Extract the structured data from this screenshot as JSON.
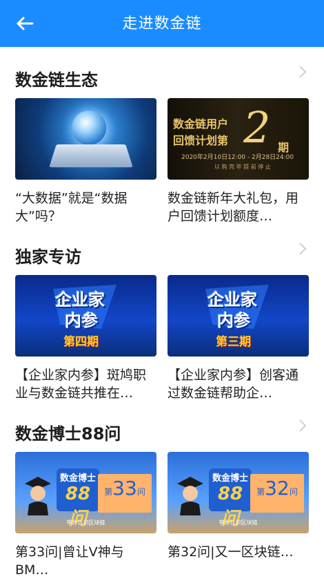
{
  "header": {
    "title": "走进数金链",
    "back_icon": "arrow-left-icon"
  },
  "sections": [
    {
      "title": "数金链生态",
      "cards": [
        {
          "caption": "“大数据”就是“数据大”吗？"
        },
        {
          "caption": "数金链新年大礼包，用户回馈计划额度…",
          "thumb_text": {
            "line1": "数金链用户",
            "line2": "回馈计划第",
            "number": "2",
            "qi": "期",
            "date": "2020年2月10日12:00 - 2月28日24:00",
            "sub": "以 购 完 毕 提 前 停 止"
          }
        }
      ]
    },
    {
      "title": "独家专访",
      "cards": [
        {
          "caption": "【企业家内参】斑鸠职业与数金链共推在…",
          "thumb_text": {
            "line1": "企业家",
            "line2": "内参",
            "period": "第四期"
          }
        },
        {
          "caption": "【企业家内参】创客通过数金链帮助企…",
          "thumb_text": {
            "line1": "企业家",
            "line2": "内参",
            "period": "第三期"
          }
        }
      ]
    },
    {
      "title": "数金博士88问",
      "cards": [
        {
          "caption": "第33问|曾让V神与BM…",
          "thumb_text": {
            "l1": "数金博士",
            "l2": "88问",
            "pre": "第",
            "num": "33",
            "post": "问",
            "tag": "带你认识区块链"
          }
        },
        {
          "caption": "第32问|又一区块链…",
          "thumb_text": {
            "l1": "数金博士",
            "l2": "88问",
            "pre": "第",
            "num": "32",
            "post": "问",
            "tag": "带你认识区块链"
          }
        }
      ]
    }
  ],
  "colors": {
    "accent": "#1a8cff",
    "chevron": "#cfcfcf"
  }
}
